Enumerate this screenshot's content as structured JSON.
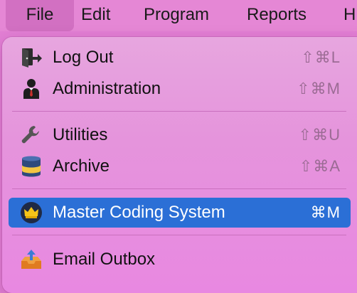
{
  "menubar": {
    "items": [
      {
        "label": "File"
      },
      {
        "label": "Edit"
      },
      {
        "label": "Program"
      },
      {
        "label": "Reports"
      },
      {
        "label": "H"
      }
    ]
  },
  "menu": {
    "items": [
      {
        "label": "Log Out",
        "shortcut": "⇧⌘L",
        "icon": "logout-door-icon"
      },
      {
        "label": "Administration",
        "shortcut": "⇧⌘M",
        "icon": "admin-person-icon"
      },
      {
        "label": "Utilities",
        "shortcut": "⇧⌘U",
        "icon": "wrench-icon"
      },
      {
        "label": "Archive",
        "shortcut": "⇧⌘A",
        "icon": "database-icon"
      },
      {
        "label": "Master Coding System",
        "shortcut": "⌘M",
        "icon": "crown-icon"
      },
      {
        "label": "Email Outbox",
        "shortcut": "",
        "icon": "outbox-tray-icon"
      }
    ]
  }
}
